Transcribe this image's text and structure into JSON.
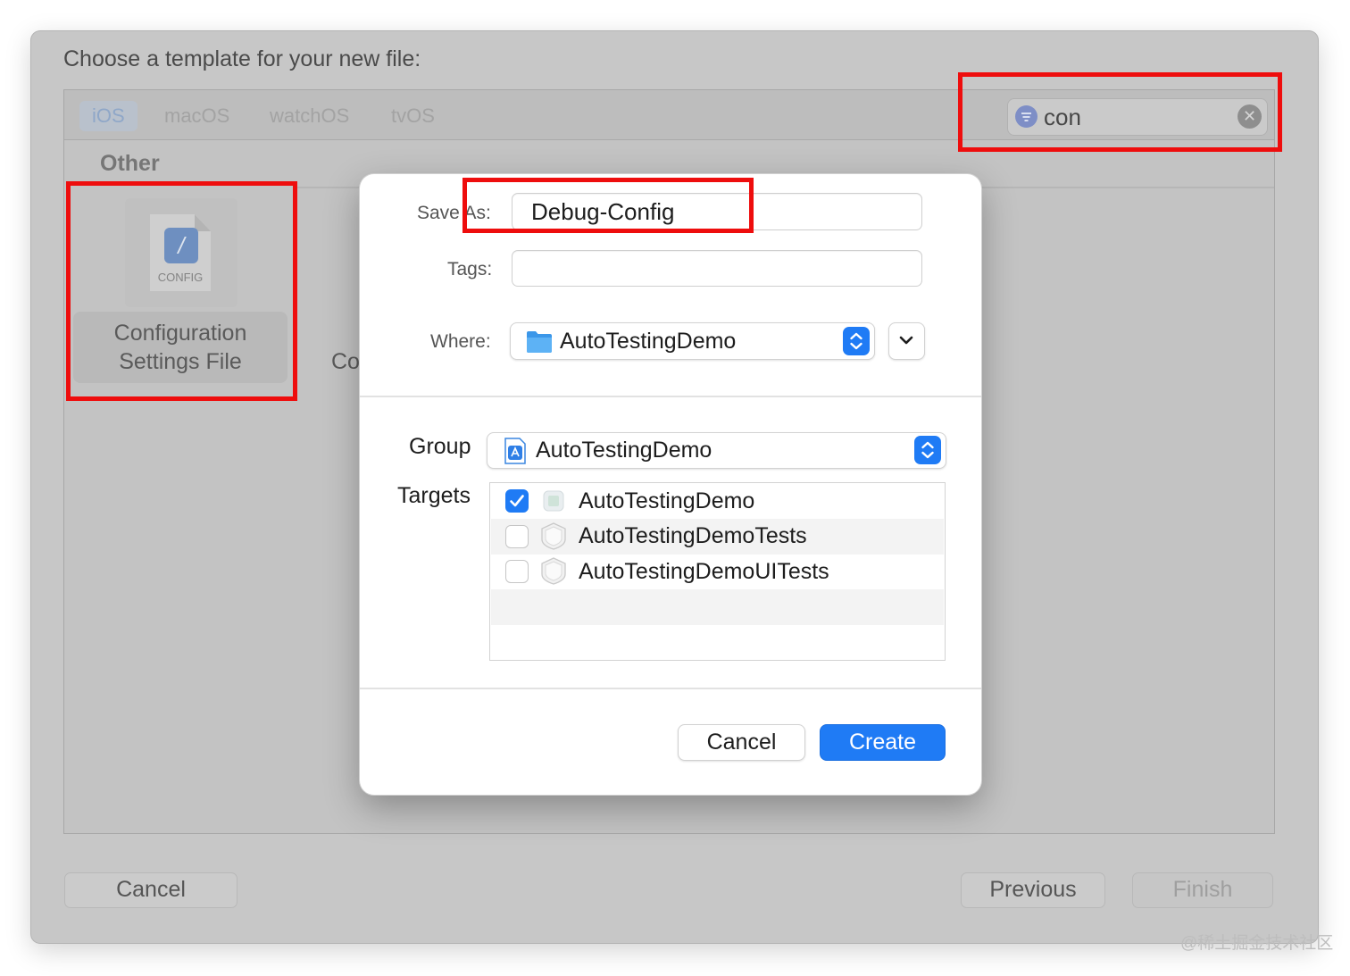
{
  "window": {
    "title": "Choose a template for your new file:",
    "platform_tabs": [
      "iOS",
      "macOS",
      "watchOS",
      "tvOS"
    ],
    "selected_platform": "iOS",
    "search": {
      "value": "con",
      "filter_icon": "filter-icon",
      "clear_icon": "clear-icon"
    },
    "section": "Other",
    "templates": [
      {
        "icon_label": "CONFIG",
        "label_line1": "Configuration",
        "label_line2": "Settings File"
      },
      {
        "label_partial": "Co"
      }
    ],
    "buttons": {
      "cancel": "Cancel",
      "previous": "Previous",
      "finish": "Finish"
    }
  },
  "dialog": {
    "save_as_label": "Save As:",
    "save_as_value": "Debug-Config",
    "tags_label": "Tags:",
    "tags_value": "",
    "where_label": "Where:",
    "where_value": "AutoTestingDemo",
    "group_label": "Group",
    "group_value": "AutoTestingDemo",
    "targets_label": "Targets",
    "targets": [
      {
        "name": "AutoTestingDemo",
        "checked": true
      },
      {
        "name": "AutoTestingDemoTests",
        "checked": false
      },
      {
        "name": "AutoTestingDemoUITests",
        "checked": false
      }
    ],
    "cancel_label": "Cancel",
    "create_label": "Create"
  },
  "colors": {
    "accent": "#1f7bf5",
    "annotation": "#ee0d0d"
  },
  "watermark": "@稀土掘金技术社区"
}
